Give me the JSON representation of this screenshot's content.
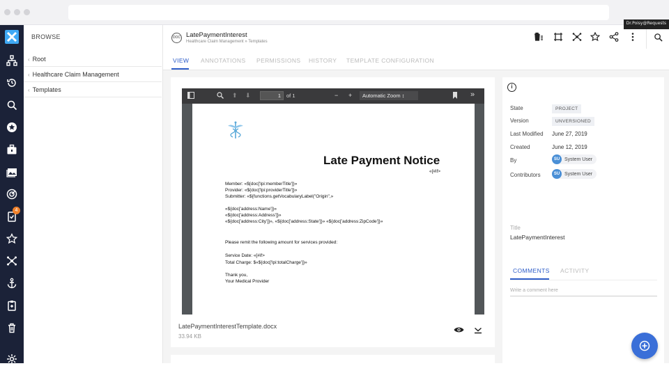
{
  "top_right_badge": "Dr.Poisy@Requests",
  "rail": {
    "icons": [
      "hierarchy-icon",
      "history-icon",
      "search-icon",
      "star-circle-icon",
      "briefcase-icon",
      "gallery-icon",
      "dashboard-icon",
      "tasks-icon",
      "favorites-star-icon",
      "network-icon",
      "anchor-icon",
      "clipboard-icon",
      "trash-icon",
      "settings-icon"
    ],
    "notification_count": "4"
  },
  "browse": {
    "title": "BROWSE",
    "items": [
      {
        "label": "Root"
      },
      {
        "label": "Healthcare Claim Management"
      },
      {
        "label": "Templates"
      }
    ]
  },
  "document": {
    "type_icon_label": "DOC",
    "title": "LatePaymentInterest",
    "breadcrumb": "Healthcare Claim Management » Templates"
  },
  "toolbar_icons": [
    "trash-list-icon",
    "crop-icon",
    "network-icon",
    "star-icon",
    "share-icon",
    "more-vert-icon",
    "search-icon"
  ],
  "tabs": [
    {
      "label": "VIEW",
      "active": true
    },
    {
      "label": "ANNOTATIONS"
    },
    {
      "label": "PERMISSIONS"
    },
    {
      "label": "HISTORY"
    },
    {
      "label": "TEMPLATE CONFIGURATION"
    }
  ],
  "viewer": {
    "page_number": "1",
    "page_count": "of 1",
    "zoom": "Automatic Zoom",
    "zoom_caret": "↕",
    "minus": "−",
    "plus": "+",
    "more": "»"
  },
  "letter": {
    "heading": "Late Payment Notice",
    "if_mark": "«[#if>",
    "lines": [
      "Member: «${doc['lpi:memberTitle']}»",
      "Provider: «${doc['lpi:providerTitle']}»",
      "Submitter: «${functions.getVocabularyLabel(\"Origin\",»",
      "«${doc['address:Name']}»",
      "«${doc['address:Address']}»",
      "«${doc['address:City']}», «${doc['address:State']}»  «${doc['address:ZipCode']}»",
      "Please remit the following amount for services provided:",
      "Service Date: «[#if>",
      "Total Charge: $«${doc['lpi:totalCharge']}»",
      "Thank you,",
      "Your Medical Provider"
    ]
  },
  "file": {
    "name": "LatePaymentInterestTemplate.docx",
    "size": "33.94 KB"
  },
  "metadata": {
    "state_label": "State",
    "state_value": "PROJECT",
    "version_label": "Version",
    "version_value": "UNVERSIONED",
    "modified_label": "Last Modified",
    "modified_value": "June 27, 2019",
    "created_label": "Created",
    "created_value": "June 12, 2019",
    "by_label": "By",
    "by_user_initials": "SU",
    "by_user": "System User",
    "contributors_label": "Contributors",
    "contributor_initials": "SU",
    "contributor": "System User",
    "title_label": "Title",
    "title_value": "LatePaymentInterest"
  },
  "comments": {
    "tab_comments": "COMMENTS",
    "tab_activity": "ACTIVITY",
    "placeholder": "Write a comment here"
  },
  "colors": {
    "rail_bg": "#1b2238",
    "accent": "#2d5cc8",
    "fab": "#3a6fd8",
    "logo": "#3fa9f5",
    "notification": "#f0812b"
  }
}
